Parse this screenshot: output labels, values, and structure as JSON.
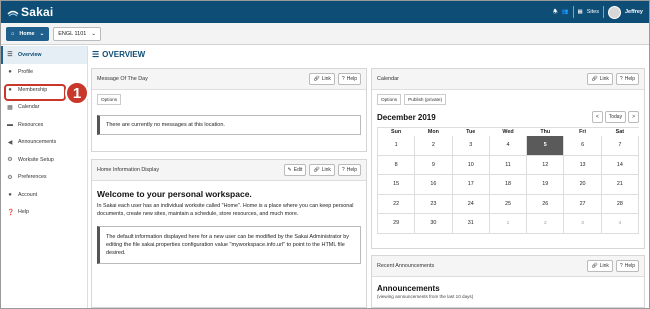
{
  "header": {
    "logo_text": "Sakai",
    "sites_label": "Sites",
    "user_name": "Jeffrey"
  },
  "sitebar": {
    "home_label": "Home",
    "course_label": "ENGL 1101"
  },
  "sidebar": {
    "items": [
      {
        "label": "Overview",
        "icon": "list-icon"
      },
      {
        "label": "Profile",
        "icon": "user-icon"
      },
      {
        "label": "Membership",
        "icon": "users-icon"
      },
      {
        "label": "Calendar",
        "icon": "calendar-icon"
      },
      {
        "label": "Resources",
        "icon": "folder-icon"
      },
      {
        "label": "Announcements",
        "icon": "megaphone-icon"
      },
      {
        "label": "Worksite Setup",
        "icon": "gears-icon"
      },
      {
        "label": "Preferences",
        "icon": "sliders-icon"
      },
      {
        "label": "Account",
        "icon": "account-icon"
      },
      {
        "label": "Help",
        "icon": "help-icon"
      }
    ],
    "callout_number": "1"
  },
  "main": {
    "title": "OVERVIEW"
  },
  "motd": {
    "title": "Message Of The Day",
    "link_label": "Link",
    "help_label": "Help",
    "tab_options": "Options",
    "message": "There are currently no messages at this location."
  },
  "home_info": {
    "title": "Home Information Display",
    "edit_label": "Edit",
    "link_label": "Link",
    "help_label": "Help",
    "heading": "Welcome to your personal workspace.",
    "paragraph": "In Sakai each user has an individual worksite called \"Home\". Home is a place where you can keep personal documents, create new sites, maintain a schedule, store resources, and much more.",
    "note": "The default information displayed here for a new user can be modified by the Sakai Administrator by editing the file sakai.properties configuration value \"myworkspace.info.url\" to point to the HTML file desired."
  },
  "calendar": {
    "title": "Calendar",
    "link_label": "Link",
    "help_label": "Help",
    "tab_options": "Options",
    "tab_publish": "Publish (private)",
    "month": "December 2019",
    "prev": "<",
    "today_label": "Today",
    "next": ">",
    "weekdays": [
      "Sun",
      "Mon",
      "Tue",
      "Wed",
      "Thu",
      "Fri",
      "Sat"
    ],
    "weeks": [
      [
        "1",
        "2",
        "3",
        "4",
        "5",
        "6",
        "7"
      ],
      [
        "8",
        "9",
        "10",
        "11",
        "12",
        "13",
        "14"
      ],
      [
        "15",
        "16",
        "17",
        "18",
        "19",
        "20",
        "21"
      ],
      [
        "22",
        "23",
        "24",
        "25",
        "26",
        "27",
        "28"
      ],
      [
        "29",
        "30",
        "31",
        "1",
        "2",
        "3",
        "4"
      ]
    ],
    "today_day": "5"
  },
  "announcements": {
    "title": "Recent Announcements",
    "link_label": "Link",
    "help_label": "Help",
    "heading": "Announcements",
    "subtitle": "(viewing announcements from the last 10 days)"
  },
  "colors": {
    "brand": "#0e4d75",
    "callout": "#c8372a"
  }
}
